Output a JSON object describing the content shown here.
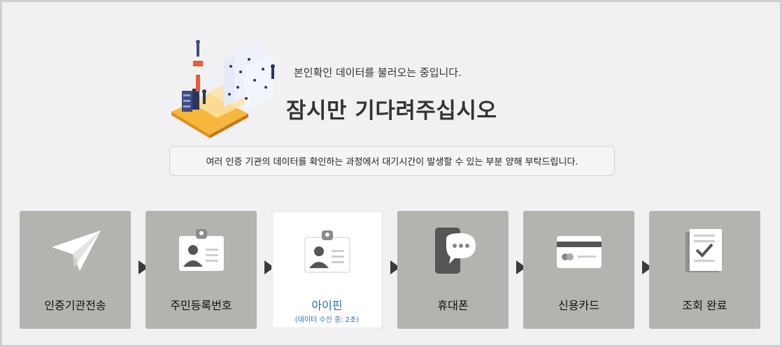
{
  "loading": {
    "sub_message": "본인확인 데이터를 불러오는 중입니다.",
    "main_message": "잠시만 기다려주십시오",
    "notice": "여러 인증 기관의 데이터를 확인하는 과정에서 대기시간이 발생할 수 있는 부분 양해 부탁드립니다."
  },
  "steps": [
    {
      "label": "인증기관전송",
      "icon": "paper-plane-icon"
    },
    {
      "label": "주민등록번호",
      "icon": "id-card-icon"
    },
    {
      "label": "아이핀",
      "icon": "id-card-icon",
      "status": "(데이터 수신 중: 2초)",
      "active": true
    },
    {
      "label": "휴대폰",
      "icon": "mobile-chat-icon"
    },
    {
      "label": "신용카드",
      "icon": "credit-card-icon"
    },
    {
      "label": "조회 완료",
      "icon": "document-check-icon"
    }
  ],
  "colors": {
    "step_bg": "#b3b4af",
    "active_text": "#2a6fb0",
    "arrow": "#3a3a3a"
  }
}
